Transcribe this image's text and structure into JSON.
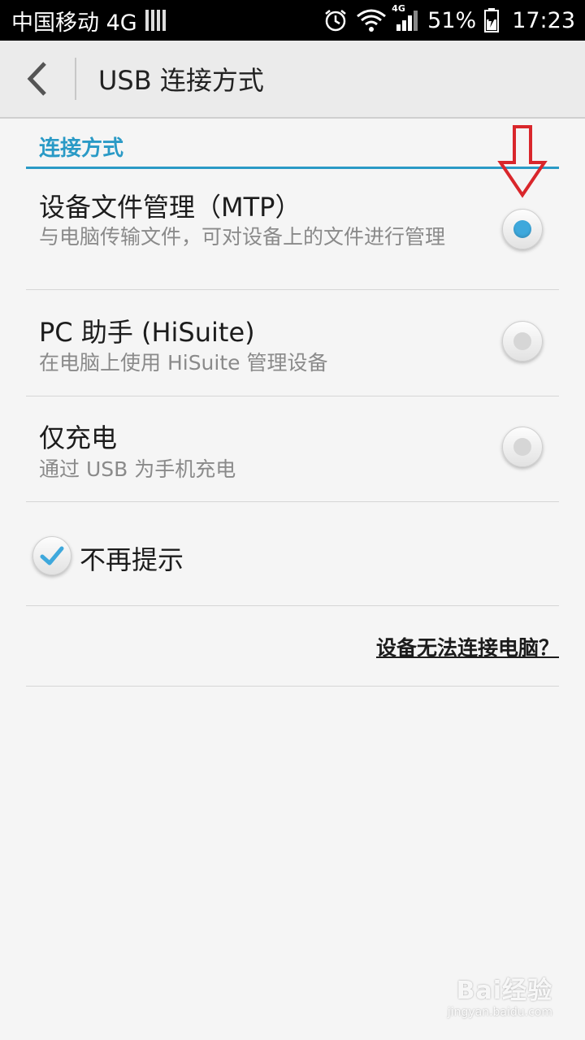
{
  "status_bar": {
    "carrier": "中国移动 4G",
    "network_type": "4G",
    "battery_percent": "51%",
    "time": "17:23",
    "icons": [
      "signal-bars-icon",
      "alarm-icon",
      "wifi-icon",
      "cell-signal-icon",
      "battery-charging-icon"
    ]
  },
  "header": {
    "title": "USB 连接方式",
    "back_icon": "back-chevron-icon"
  },
  "section": {
    "label": "连接方式",
    "accent_color": "#2a9ac6"
  },
  "options": [
    {
      "title": "设备文件管理（MTP）",
      "description": "与电脑传输文件，可对设备上的文件进行管理",
      "selected": true
    },
    {
      "title": "PC 助手 (HiSuite)",
      "description": "在电脑上使用 HiSuite 管理设备",
      "selected": false
    },
    {
      "title": "仅充电",
      "description": "通过 USB 为手机充电",
      "selected": false
    }
  ],
  "dont_remind": {
    "label": "不再提示",
    "checked": true
  },
  "help_link": {
    "label": "设备无法连接电脑？"
  },
  "annotation": {
    "arrow_color": "#d9262b"
  },
  "watermark": {
    "logo": "Bai经验",
    "url": "jingyan.baidu.com"
  }
}
